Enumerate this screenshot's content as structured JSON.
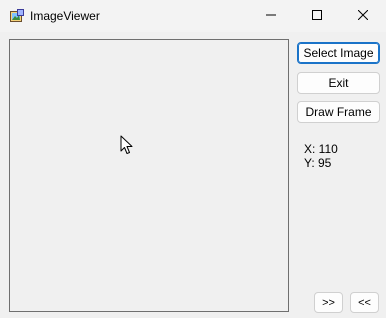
{
  "window": {
    "title": "ImageViewer",
    "icon": "app-image-icon",
    "controls": [
      "minimize-icon",
      "maximize-icon",
      "close-icon"
    ]
  },
  "buttons": {
    "select_image": "Select Image",
    "exit": "Exit",
    "draw_frame": "Draw Frame",
    "next": ">>",
    "prev": "<<"
  },
  "coordinates": {
    "x_label": "X: 110",
    "y_label": "Y: 95"
  },
  "colors": {
    "focus_border": "#1a73c8",
    "background": "#f0f0f0"
  }
}
